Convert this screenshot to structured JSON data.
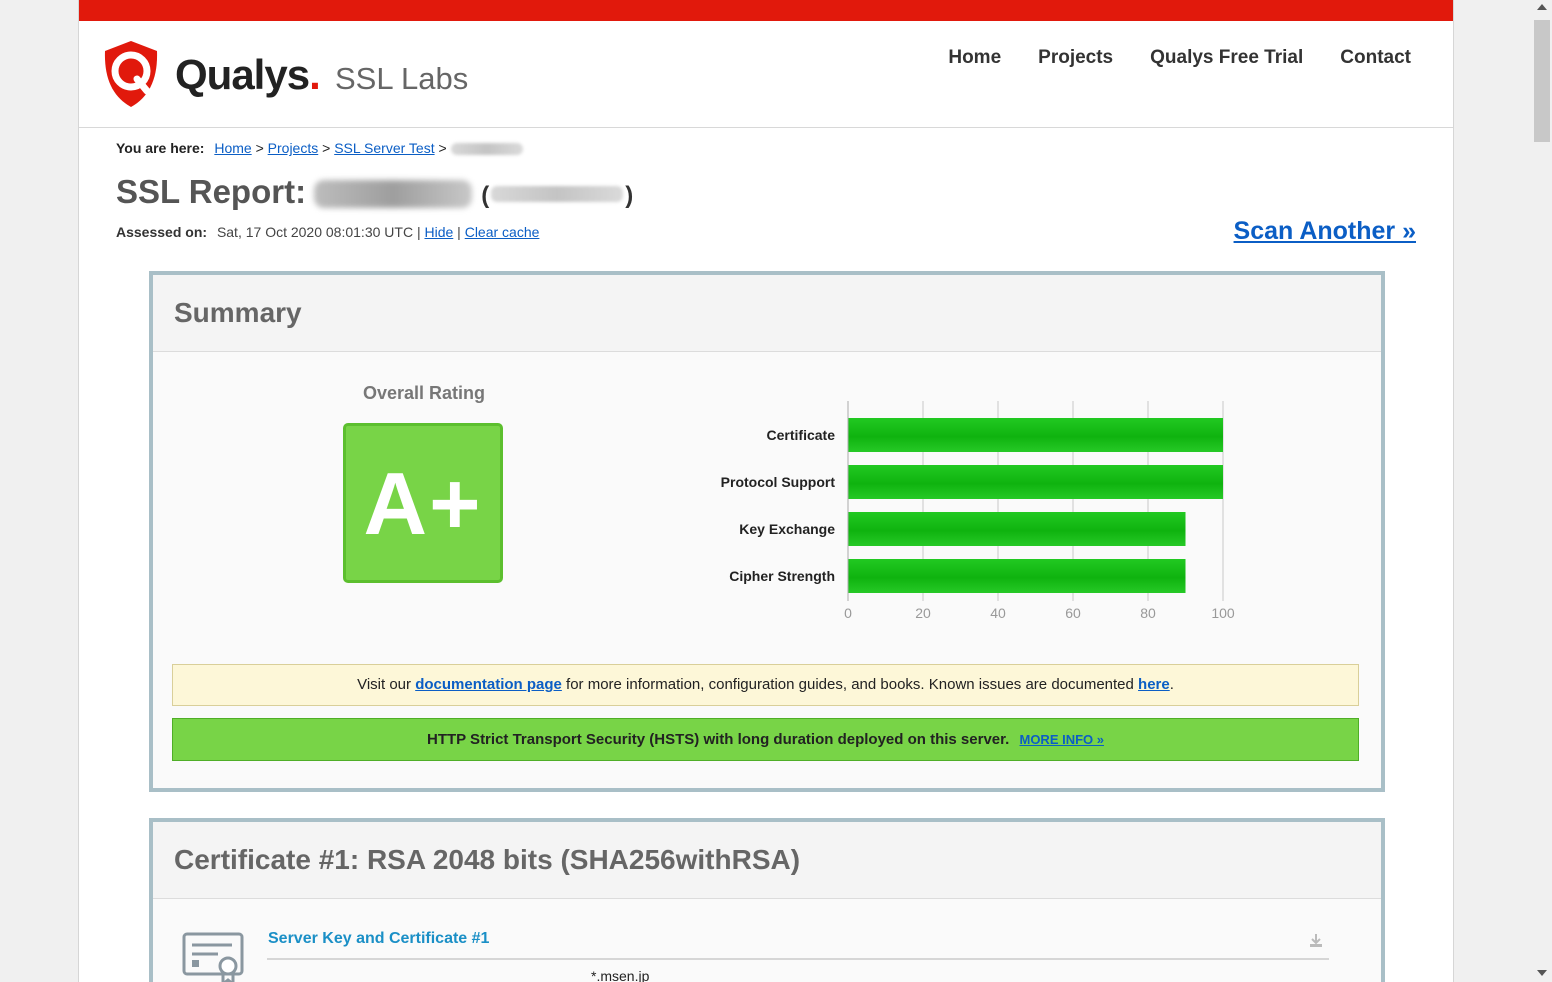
{
  "header": {
    "brand": "Qualys",
    "brand_dot": ".",
    "brand_sub": "SSL Labs",
    "nav": [
      "Home",
      "Projects",
      "Qualys Free Trial",
      "Contact"
    ],
    "accent_color": "#e1190c"
  },
  "breadcrumb": {
    "label": "You are here:",
    "items": [
      "Home",
      "Projects",
      "SSL Server Test"
    ],
    "separator": ">"
  },
  "report": {
    "title_prefix": "SSL Report:",
    "assessed_label": "Assessed on:",
    "assessed_date": "Sat, 17 Oct 2020 08:01:30 UTC",
    "hide_link": "Hide",
    "clear_cache_link": "Clear cache",
    "pipe": "|",
    "scan_another": "Scan Another »"
  },
  "summary": {
    "heading": "Summary",
    "overall_rating_label": "Overall Rating",
    "grade": "A+",
    "grade_color": "#78d447",
    "doc_notice": {
      "pre": "Visit our",
      "link1": "documentation page",
      "mid": "for more information, configuration guides, and books. Known issues are documented",
      "link2": "here",
      "post": "."
    },
    "hsts_notice": {
      "text": "HTTP Strict Transport Security (HSTS) with long duration deployed on this server.",
      "link": "MORE INFO »"
    }
  },
  "chart_data": {
    "type": "bar",
    "orientation": "horizontal",
    "categories": [
      "Certificate",
      "Protocol Support",
      "Key Exchange",
      "Cipher Strength"
    ],
    "values": [
      100,
      100,
      90,
      90
    ],
    "xlim": [
      0,
      100
    ],
    "xticks": [
      0,
      20,
      40,
      60,
      80,
      100
    ],
    "grid": true,
    "bar_color": "#1fbf1f"
  },
  "certificate": {
    "heading": "Certificate #1: RSA 2048 bits (SHA256withRSA)",
    "subheading": "Server Key and Certificate #1",
    "common_name": "*.msen.jp"
  }
}
